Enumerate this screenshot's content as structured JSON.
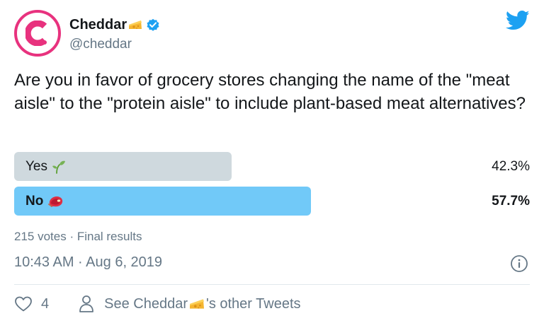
{
  "author": {
    "display_name": "Cheddar",
    "handle": "@cheddar"
  },
  "tweet": {
    "text": "Are you in favor of grocery stores changing the name of the \"meat aisle\" to the \"protein aisle\" to include plant-based meat alternatives?"
  },
  "poll": {
    "options": [
      {
        "label": "Yes",
        "emoji": "seedling-icon",
        "percent_label": "42.3%",
        "percent": 42.3,
        "winner": false
      },
      {
        "label": "No",
        "emoji": "meat-icon",
        "percent_label": "57.7%",
        "percent": 57.7,
        "winner": true
      }
    ],
    "summary": "215 votes · Final results"
  },
  "timestamp": "10:43 AM · Aug 6, 2019",
  "footer": {
    "like_count": "4",
    "other_tweets_prefix": "See Cheddar",
    "other_tweets_suffix": "'s other Tweets"
  },
  "colors": {
    "brand_pink": "#e8327e",
    "verified_blue": "#1da1f2",
    "winner_bar": "#71c9f8",
    "loser_bar": "#cfd9de",
    "secondary_text": "#657786"
  }
}
